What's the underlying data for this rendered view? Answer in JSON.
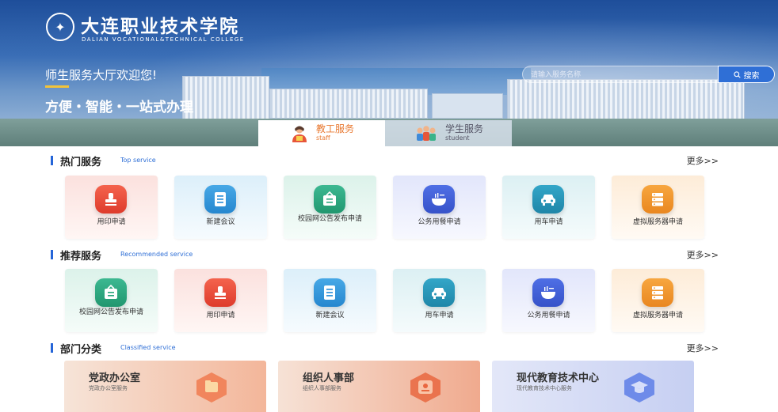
{
  "header": {
    "school_cn": "大连职业技术学院",
    "school_en": "DALIAN VOCATIONAL&TECHNICAL COLLEGE",
    "welcome": "师生服务大厅欢迎您!",
    "slogan": "方便・智能・一站式办理",
    "search_placeholder": "请输入服务名称",
    "search_button": "搜索"
  },
  "tabs": [
    {
      "label": "教工服务",
      "sub": "staff",
      "active": true
    },
    {
      "label": "学生服务",
      "sub": "student",
      "active": false
    }
  ],
  "hot": {
    "title": "热门服务",
    "subtitle": "Top service",
    "more": "更多>>",
    "items": [
      {
        "label": "用印申请",
        "icon": "stamp-icon",
        "theme": "red"
      },
      {
        "label": "新建会议",
        "icon": "document-icon",
        "theme": "blue"
      },
      {
        "label": "校园网公告发布申请",
        "icon": "notice-icon",
        "theme": "green"
      },
      {
        "label": "公务用餐申请",
        "icon": "bowl-icon",
        "theme": "indigo"
      },
      {
        "label": "用车申请",
        "icon": "car-icon",
        "theme": "cyan"
      },
      {
        "label": "虚拟服务器申请",
        "icon": "server-icon",
        "theme": "orange"
      }
    ]
  },
  "recommended": {
    "title": "推荐服务",
    "subtitle": "Recommended service",
    "more": "更多>>",
    "items": [
      {
        "label": "校园网公告发布申请",
        "icon": "notice-icon",
        "theme": "green"
      },
      {
        "label": "用印申请",
        "icon": "stamp-icon",
        "theme": "red"
      },
      {
        "label": "新建会议",
        "icon": "document-icon",
        "theme": "blue"
      },
      {
        "label": "用车申请",
        "icon": "car-icon",
        "theme": "cyan"
      },
      {
        "label": "公务用餐申请",
        "icon": "bowl-icon",
        "theme": "indigo"
      },
      {
        "label": "虚拟服务器申请",
        "icon": "server-icon",
        "theme": "orange"
      }
    ]
  },
  "departments": {
    "title": "部门分类",
    "subtitle": "Classified service",
    "more": "更多>>",
    "items": [
      {
        "name": "党政办公室",
        "desc": "党政办公室服务",
        "color": "#f07a4f"
      },
      {
        "name": "组织人事部",
        "desc": "组织人事部服务",
        "color": "#e9673f"
      },
      {
        "name": "现代教育技术中心",
        "desc": "现代教育技术中心服务",
        "color": "#5d7ee6"
      }
    ]
  }
}
